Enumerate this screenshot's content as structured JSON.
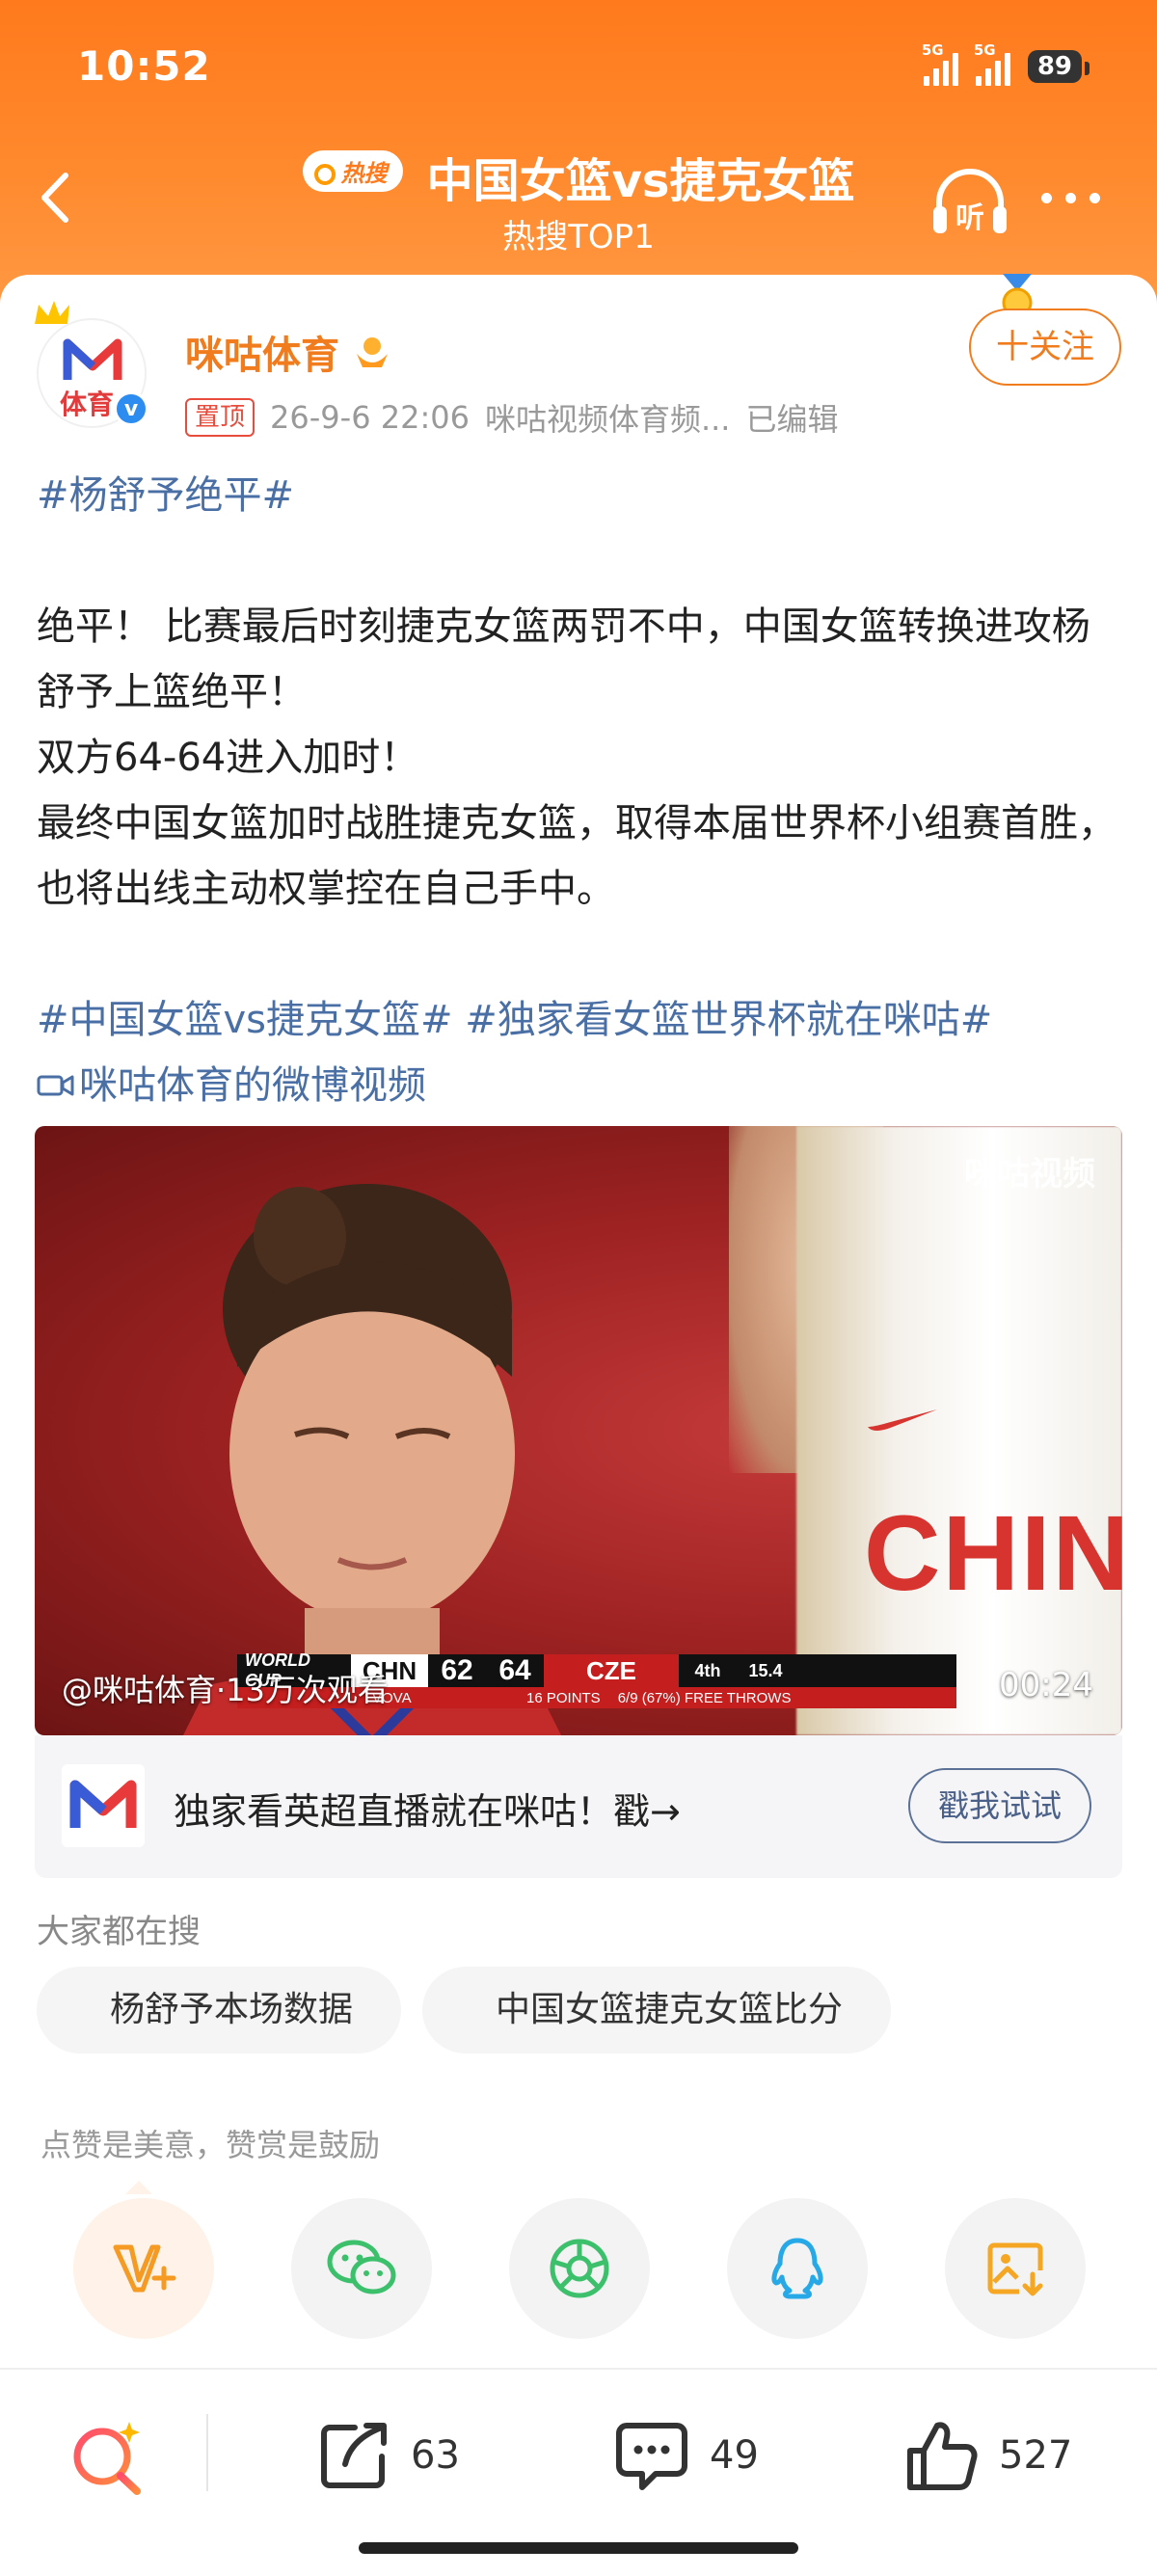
{
  "status_bar": {
    "time": "10:52",
    "signal1": "5G",
    "signal2": "5G",
    "battery": "89"
  },
  "header": {
    "hot_badge": "热搜",
    "title": "中国女篮vs捷克女篮",
    "subtitle": "热搜TOP1"
  },
  "post": {
    "author": "咪咕体育",
    "avatar_text": "体育",
    "pin_label": "置顶",
    "timestamp": "26-9-6 22:06",
    "source": "咪咕视频体育频...",
    "edited": "已编辑",
    "follow_label": "十关注",
    "hashtag_top": "#杨舒予绝平#",
    "paragraph1": "绝平！ 比赛最后时刻捷克女篮两罚不中，中国女篮转换进攻杨舒予上篮绝平！",
    "paragraph2": "双方64-64进入加时！",
    "paragraph3": "最终中国女篮加时战胜捷克女篮，取得本届世界杯小组赛首胜，也将出线主动权掌控在自己手中。",
    "hashtag_a": "#中国女篮vs捷克女篮#",
    "hashtag_b": "#独家看女篮世界杯就在咪咕#",
    "video_link": "咪咕体育的微博视频"
  },
  "video": {
    "watermark": "咪咕视频",
    "views": "@咪咕体育·13万次观看",
    "duration": "00:24",
    "jersey_text": "CHIN",
    "scorebug": {
      "event": "WORLD CUP",
      "team1": "CHN",
      "score1": "62",
      "score2": "64",
      "team2": "CZE",
      "period": "4th",
      "clock": "15.4",
      "player": "VOVA",
      "stat_points": "16 POINTS",
      "stat_ft": "6/9 (67%) FREE THROWS"
    }
  },
  "ad": {
    "text": "独家看英超直播就在咪咕！戳→",
    "button": "戳我试试"
  },
  "searches": {
    "label": "大家都在搜",
    "items": [
      "杨舒予本场数据",
      "中国女篮捷克女篮比分"
    ]
  },
  "reward": {
    "label": "点赞是美意，赞赏是鼓励"
  },
  "share_icons": [
    "reward-v-icon",
    "wechat-icon",
    "moments-icon",
    "qq-icon",
    "save-image-icon"
  ],
  "bottom_bar": {
    "repost_count": "63",
    "comment_count": "49",
    "like_count": "527"
  },
  "colors": {
    "header_orange": "#ff7a1c",
    "author_orange": "#f07c1e",
    "hashtag_blue": "#4a6fa5"
  }
}
